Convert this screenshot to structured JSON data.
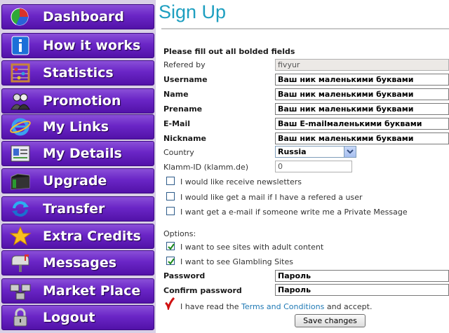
{
  "sidebar": {
    "items": [
      {
        "label": "Dashboard",
        "icon": "pie-chart-icon"
      },
      {
        "label": "How it works",
        "icon": "info-icon"
      },
      {
        "label": "Statistics",
        "icon": "abacus-icon"
      },
      {
        "label": "Promotion",
        "icon": "users-icon"
      },
      {
        "label": "My Links",
        "icon": "browser-icon"
      },
      {
        "label": "My Details",
        "icon": "card-icon"
      },
      {
        "label": "Upgrade",
        "icon": "folder-icon"
      },
      {
        "label": "Transfer",
        "icon": "refresh-icon"
      },
      {
        "label": "Extra Credits",
        "icon": "star-icon"
      },
      {
        "label": "Messages",
        "icon": "mailbox-icon"
      },
      {
        "label": "Market Place",
        "icon": "network-icon"
      },
      {
        "label": "Logout",
        "icon": "lock-icon"
      }
    ]
  },
  "page": {
    "title": "Sign Up",
    "instruction": "Please fill out all bolded fields"
  },
  "form": {
    "refered_by": {
      "label": "Refered by",
      "value": "fivyur"
    },
    "username": {
      "label": "Username",
      "value": "Ваш ник маленькими буквами"
    },
    "name": {
      "label": "Name",
      "value": "Ваш ник маленькими буквами"
    },
    "prename": {
      "label": "Prename",
      "value": "Ваш ник маленькими буквами"
    },
    "email": {
      "label": "E-Mail",
      "value": "Ваш E-mailмаленькими буквами"
    },
    "nickname": {
      "label": "Nickname",
      "value": "Ваш ник маленькими буквами"
    },
    "country": {
      "label": "Country",
      "value": "Russia"
    },
    "klamm": {
      "label": "Klamm-ID (klamm.de)",
      "value": "0"
    },
    "newsletters": {
      "label": "I would like receive newsletters",
      "checked": false
    },
    "referral_mail": {
      "label": "I would like get a mail if I have a refered a user",
      "checked": false
    },
    "pm_mail": {
      "label": "I want get a e-mail if someone write me a Private Message",
      "checked": false
    },
    "options_label": "Options:",
    "adult": {
      "label": "I want to see sites with adult content",
      "checked": true
    },
    "gambling": {
      "label": "I want to see Glambling Sites",
      "checked": true
    },
    "password": {
      "label": "Password",
      "value": "Пароль"
    },
    "confirm_password": {
      "label": "Confirm password",
      "value": "Пароль"
    },
    "terms": {
      "prefix": "I have read the ",
      "link": "Terms and Conditions",
      "suffix": " and accept."
    },
    "submit": "Save changes"
  },
  "colors": {
    "accent": "#1e9fc0",
    "nav": "#6a25c6",
    "link": "#1e78b4"
  }
}
